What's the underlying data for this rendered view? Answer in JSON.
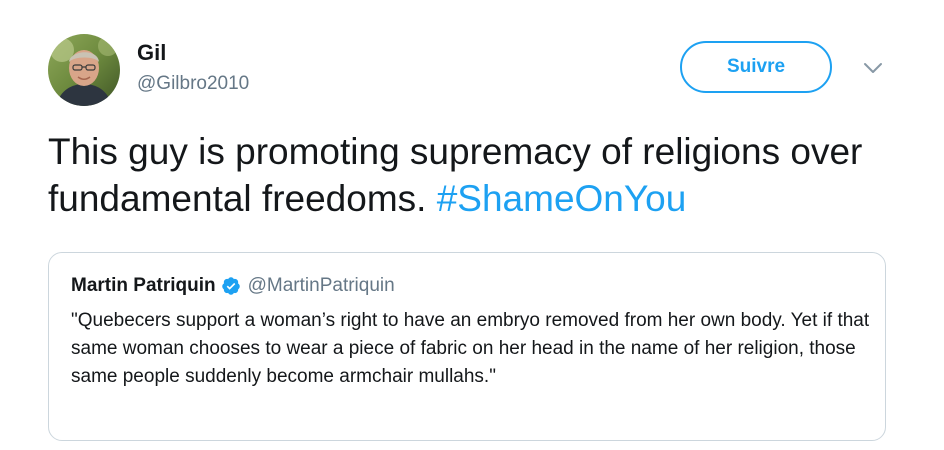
{
  "author": {
    "display_name": "Gil",
    "handle": "@Gilbro2010",
    "avatar": "profile-photo"
  },
  "follow_button": {
    "label": "Suivre",
    "color": "#1da1f2"
  },
  "menu": {
    "icon": "chevron-down-icon"
  },
  "tweet": {
    "text": "This guy is promoting supremacy of religions over fundamental freedoms.",
    "hashtag": "#ShameOnYou",
    "hashtag_color": "#1da1f2"
  },
  "quoted_tweet": {
    "display_name": "Martin Patriquin",
    "verified": true,
    "verified_icon": "verified-badge-icon",
    "handle": "@MartinPatriquin",
    "text": "\"Quebecers support a woman’s right to have an embryo removed from her own body. Yet if that same woman chooses to wear a piece of fabric on her head in the name of her religion, those same people suddenly become armchair mullahs.\""
  }
}
